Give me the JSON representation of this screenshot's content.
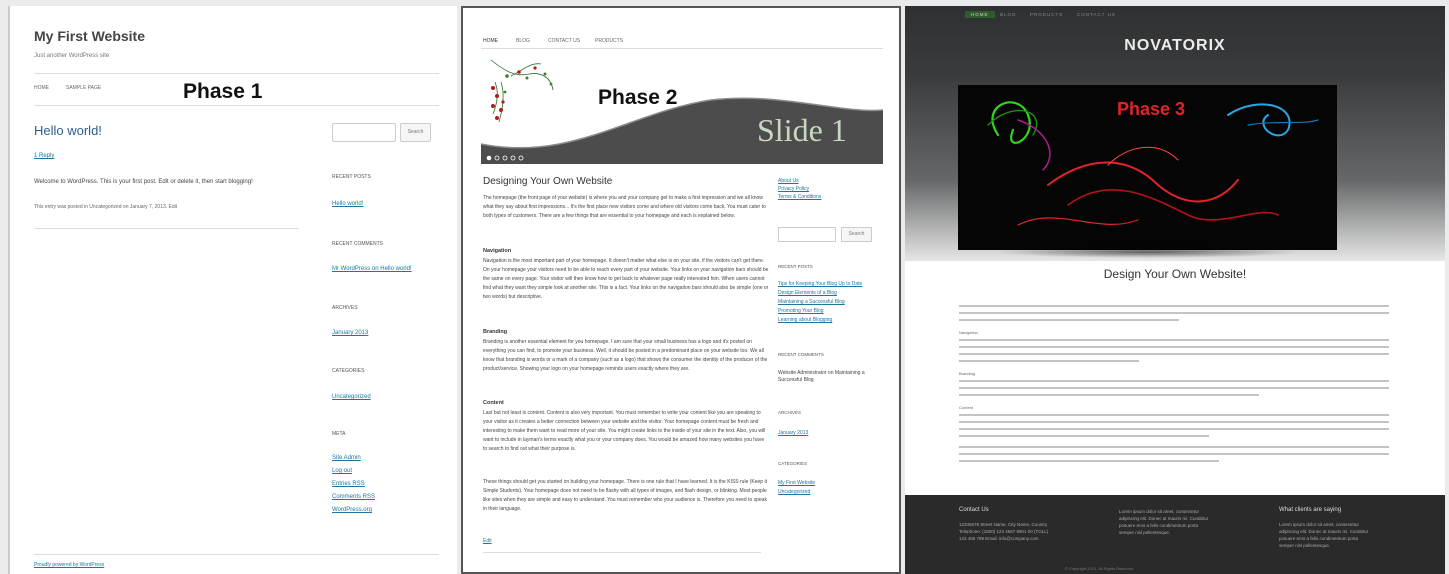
{
  "phase1": {
    "site_title": "My First Website",
    "tagline": "Just another WordPress site",
    "nav": [
      "HOME",
      "SAMPLE PAGE"
    ],
    "phase_label": "Phase 1",
    "post_title": "Hello world!",
    "reply": "1 Reply",
    "content": "Welcome to WordPress. This is your first post. Edit or delete it, then start blogging!",
    "meta": "This entry was posted in Uncategorized on January 7, 2013. Edit",
    "search_button": "Search",
    "widgets": {
      "recent_posts_title": "RECENT POSTS",
      "recent_posts": [
        "Hello world!"
      ],
      "recent_comments_title": "RECENT COMMENTS",
      "recent_comments": [
        "Mr WordPress on Hello world!"
      ],
      "archives_title": "ARCHIVES",
      "archives": [
        "January 2013"
      ],
      "categories_title": "CATEGORIES",
      "categories": [
        "Uncategorized"
      ],
      "meta_title": "META",
      "meta_links": [
        "Site Admin",
        "Log out",
        "Entries RSS",
        "Comments RSS",
        "WordPress.org"
      ]
    },
    "footer": "Proudly powered by WordPress"
  },
  "phase2": {
    "nav": [
      "HOME",
      "BLOG",
      "CONTACT US",
      "PRODUCTS"
    ],
    "phase_label": "Phase 2",
    "slide_text": "Slide 1",
    "heading": "Designing Your Own Website",
    "intro": "The homepage (the front page of your website) is where you and your company get to make a first impression and we all know what they say about first impressions... It's the first place new visitors come and where old visitors come back. You must cater to both types of customers. There are a few things that are essential to your homepage and each is explained below.",
    "navigation_title": "Navigation",
    "navigation_text": "Navigation is the most important part of your homepage. It doesn't matter what else is on your site, if the visitors can't get there. On your homepage your visitors need to be able to reach every part of your website. Your links on your navigation bars should be the same on every page. Your visitor will then know how to get back to whatever page really interested him. When users cannot find what they want they simple look at another site. This is a fact. Your links on the navigation bars should also be simple (one or two words) but descriptive.",
    "branding_title": "Branding",
    "branding_text": "Branding is another essential element for you homepage. I am sure that your small business has a logo and it's posted on everything you can find, to promote your business. Well, it should be posted in a predominant place on your website too. We all know that branding is words or a mark of a company (such as a logo) that shows the consumer the identity of the producer of the product/service. Showing your logo on your homepage reminds users exactly where they are.",
    "content_title": "Content",
    "content_text": "Last but not least is content. Content is also very important. You must remember to write your content like you are speaking to your visitor as it creates a better connection between your website and the visitor. Your homepage content must be fresh and interesting to make them want to read more of your site. You might create links to the inside of your site in the text. Also, you will want to include in layman's terms exactly what you or your company does. You would be amazed how many websites you have to search to find out what their purpose is.",
    "closing_text": "These things should get you started on building your homepage. There is one rule that I have learned. It is the KISS rule (Keep it Simple Students). Your homepage does not need to be flashy with all types of images, and flash design, or blinking. Most people like sites when they are simple and easy to understand. You must remember who your audience is. Therefore you need to speak in their language.",
    "edit": "Edit",
    "side_links": [
      "About Us",
      "Privacy Policy",
      "Terms & Conditions"
    ],
    "search_button": "Search",
    "recent_posts_title": "RECENT POSTS",
    "recent_posts": [
      "Tips for Keeping Your Blog Up to Date",
      "Design Elements of a Blog",
      "Maintaining a Successful Blog",
      "Promoting Your Blog",
      "Learning about Blogging"
    ],
    "recent_comments_title": "RECENT COMMENTS",
    "recent_comment": "Website Administrator on Maintaining a Successful Blog",
    "archives_title": "ARCHIVES",
    "archives": [
      "January 2013"
    ],
    "categories_title": "CATEGORIES",
    "categories": [
      "My First Website",
      "Uncategorized"
    ]
  },
  "phase3": {
    "menu": [
      "HOME",
      "BLOG",
      "PRODUCTS",
      "CONTACT US"
    ],
    "logo": "NOVATORIX",
    "phase_label": "Phase 3",
    "heading": "Design Your Own Website!",
    "subheads": [
      "Navigation",
      "Branding",
      "Content"
    ],
    "footer_col1_title": "Contact Us",
    "footer_col1_lines": [
      "12345678 Street Name, City Name, Country",
      "Telephone: (1800) 123 4567 8901 00 (TOLL)",
      "123 456 789 Email: info@company.com"
    ],
    "footer_col2_lines": [
      "Lorem ipsum dolor sit amet, consectetur",
      "adipiscing elit. Donec at mauris mi. Curabitur",
      "posuere eros a felis condimentum porta",
      "semper nisl pellentesque."
    ],
    "footer_col3_title": "What clients are saying",
    "footer_col3_lines": [
      "Lorem ipsum dolor sit amet, consectetur",
      "adipiscing elit. Donec at mauris mi. Curabitur",
      "posuere eros a felis condimentum porta",
      "semper nisl pellentesque."
    ],
    "copyright": "© Copyright 2013. All Rights Reserved."
  }
}
